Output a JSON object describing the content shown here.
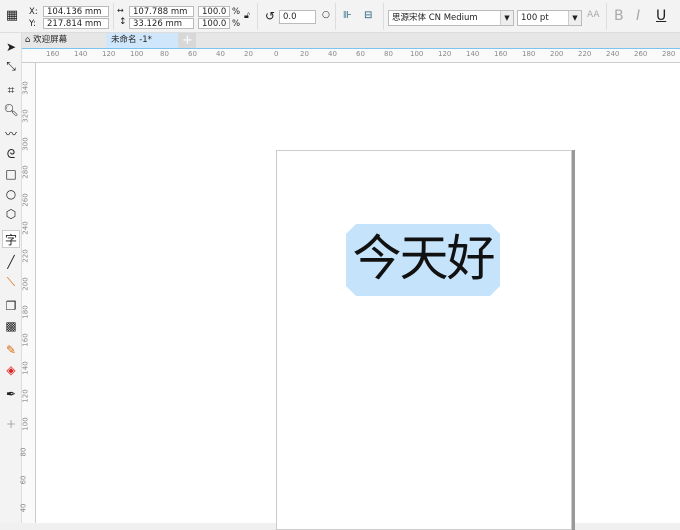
{
  "propbar": {
    "x_label": "X:",
    "y_label": "Y:",
    "x": "104.136 mm",
    "y": "217.814 mm",
    "width": "107.788 mm",
    "height": "33.126 mm",
    "scale_x": "100.0",
    "scale_y": "100.0",
    "pct": "%",
    "rotation": "0.0",
    "font": "思源宋体 CN Medium",
    "font_size": "100 pt",
    "bold": "B",
    "italic": "I",
    "underline": "U"
  },
  "tabs": [
    {
      "label": "欢迎屏幕"
    },
    {
      "label": "未命名 -1*"
    }
  ],
  "hruler": [
    "160",
    "140",
    "120",
    "100",
    "80",
    "60",
    "40",
    "20",
    "0",
    "20",
    "40",
    "60",
    "80",
    "100",
    "120",
    "140",
    "160",
    "180",
    "200",
    "220",
    "240",
    "260",
    "280"
  ],
  "vruler": [
    "340",
    "320",
    "300",
    "280",
    "260",
    "240",
    "220",
    "200",
    "180",
    "160",
    "140",
    "120",
    "100",
    "80",
    "60",
    "40"
  ],
  "canvas": {
    "text": "今天好"
  },
  "colors": {
    "selection": "#c5e3fa",
    "active_tab": "#cfe6fb"
  }
}
